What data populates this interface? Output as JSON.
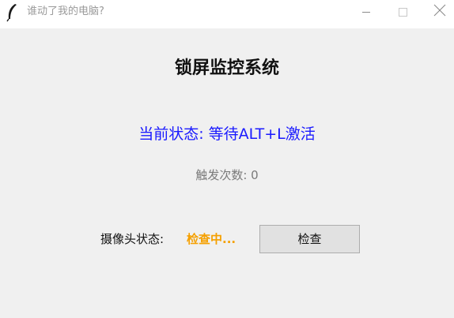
{
  "window": {
    "title": "谁动了我的电脑?",
    "app_icon": "feather-icon",
    "controls": {
      "minimize_icon": "minimize-icon",
      "maximize_icon": "maximize-icon",
      "close_icon": "close-icon"
    }
  },
  "main": {
    "heading": "锁屏监控系统",
    "status_text": "当前状态: 等待ALT+L激活",
    "trigger_count_text": "触发次数: 0",
    "camera": {
      "label": "摄像头状态:",
      "value": "检查中...",
      "check_button_label": "检查"
    }
  },
  "colors": {
    "status": "#1a1aff",
    "camera_value": "#f5a000",
    "muted_text": "#7a7a7a",
    "background": "#f0f0f0"
  }
}
